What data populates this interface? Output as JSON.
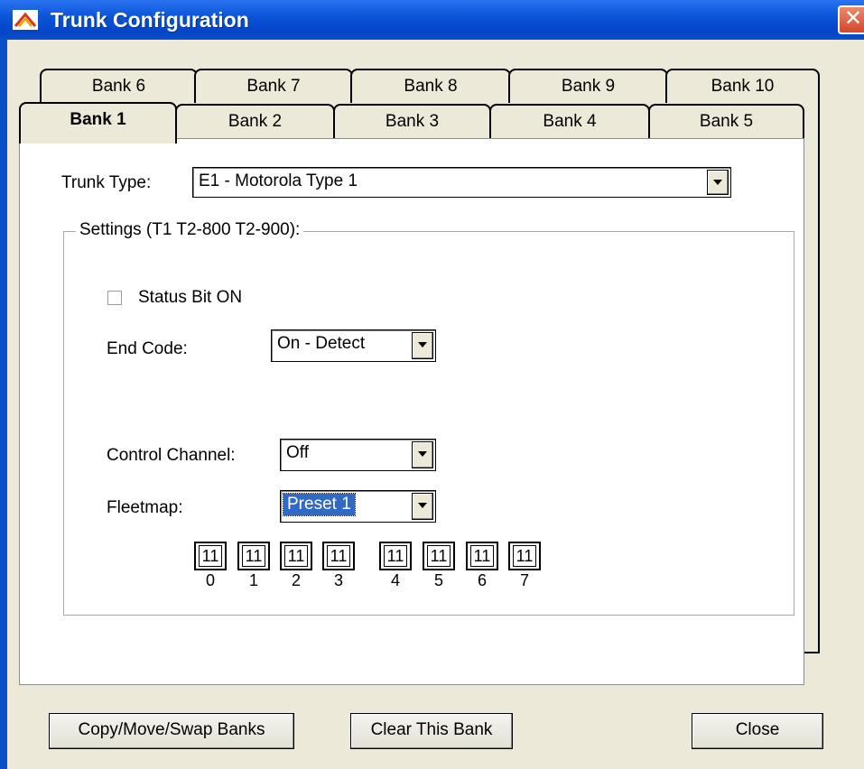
{
  "window": {
    "title": "Trunk Configuration",
    "close_glyph": "✕"
  },
  "tabs_back": [
    "Bank 6",
    "Bank 7",
    "Bank 8",
    "Bank 9",
    "Bank 10"
  ],
  "tabs_front": [
    "Bank 1",
    "Bank 2",
    "Bank 3",
    "Bank 4",
    "Bank 5"
  ],
  "trunk_type": {
    "label": "Trunk Type:",
    "value": "E1 - Motorola Type 1"
  },
  "settings": {
    "group_label": "Settings (T1 T2-800 T2-900):",
    "status_bit_label": "Status Bit ON",
    "status_bit_checked": false,
    "end_code_label": "End Code:",
    "end_code_value": "On - Detect",
    "control_channel_label": "Control Channel:",
    "control_channel_value": "Off",
    "fleetmap_label": "Fleetmap:",
    "fleetmap_value": "Preset 1",
    "fleetmap_blocks": [
      "11",
      "11",
      "11",
      "11",
      "11",
      "11",
      "11",
      "11"
    ],
    "fleetmap_indices": [
      "0",
      "1",
      "2",
      "3",
      "4",
      "5",
      "6",
      "7"
    ]
  },
  "buttons": {
    "copy": "Copy/Move/Swap Banks",
    "clear": "Clear This Bank",
    "close": "Close"
  },
  "colors": {
    "titlebar": "#0a52d6",
    "dialog_bg": "#ece9d8",
    "selection": "#316ac5",
    "close_button": "#d4472a"
  }
}
